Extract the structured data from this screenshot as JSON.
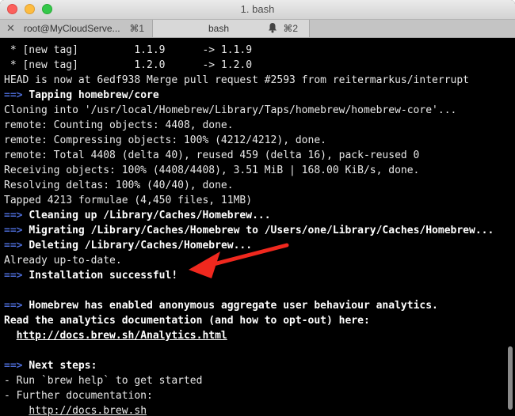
{
  "window": {
    "title": "1. bash"
  },
  "tabs": [
    {
      "label": "root@MyCloudServe...",
      "shortcut": "⌘1",
      "active": false
    },
    {
      "label": "bash",
      "shortcut": "⌘2",
      "active": true
    }
  ],
  "terminal": {
    "lines": [
      {
        "text": " * [new tag]         1.1.9      -> 1.1.9"
      },
      {
        "text": " * [new tag]         1.2.0      -> 1.2.0"
      },
      {
        "text": "HEAD is now at 6edf938 Merge pull request #2593 from reitermarkus/interrupt"
      },
      {
        "prefix": "==>",
        "text": "Tapping homebrew/core",
        "bold": true
      },
      {
        "text": "Cloning into '/usr/local/Homebrew/Library/Taps/homebrew/homebrew-core'..."
      },
      {
        "text": "remote: Counting objects: 4408, done."
      },
      {
        "text": "remote: Compressing objects: 100% (4212/4212), done."
      },
      {
        "text": "remote: Total 4408 (delta 40), reused 459 (delta 16), pack-reused 0"
      },
      {
        "text": "Receiving objects: 100% (4408/4408), 3.51 MiB | 168.00 KiB/s, done."
      },
      {
        "text": "Resolving deltas: 100% (40/40), done."
      },
      {
        "text": "Tapped 4213 formulae (4,450 files, 11MB)"
      },
      {
        "prefix": "==>",
        "text": "Cleaning up /Library/Caches/Homebrew...",
        "bold": true
      },
      {
        "prefix": "==>",
        "text": "Migrating /Library/Caches/Homebrew to /Users/one/Library/Caches/Homebrew...",
        "bold": true
      },
      {
        "prefix": "==>",
        "text": "Deleting /Library/Caches/Homebrew...",
        "bold": true
      },
      {
        "text": "Already up-to-date."
      },
      {
        "prefix": "==>",
        "text": "Installation successful!",
        "bold": true
      },
      {
        "text": ""
      },
      {
        "prefix": "==>",
        "text": "Homebrew has enabled anonymous aggregate user behaviour analytics.",
        "bold": true
      },
      {
        "text": "Read the analytics documentation (and how to opt-out) here:",
        "bold": true
      },
      {
        "indent": "  ",
        "text": "http://docs.brew.sh/Analytics.html",
        "bold": true,
        "url": true
      },
      {
        "text": ""
      },
      {
        "prefix": "==>",
        "text": "Next steps:",
        "bold": true
      },
      {
        "text": "- Run `brew help` to get started"
      },
      {
        "text": "- Further documentation:"
      },
      {
        "indent": "    ",
        "text": "http://docs.brew.sh",
        "url": true
      }
    ]
  },
  "annotation": {
    "color": "#f0281e"
  },
  "colors": {
    "arrow": "#4b6bd6",
    "text": "#e8e8e8",
    "background": "#000000"
  }
}
